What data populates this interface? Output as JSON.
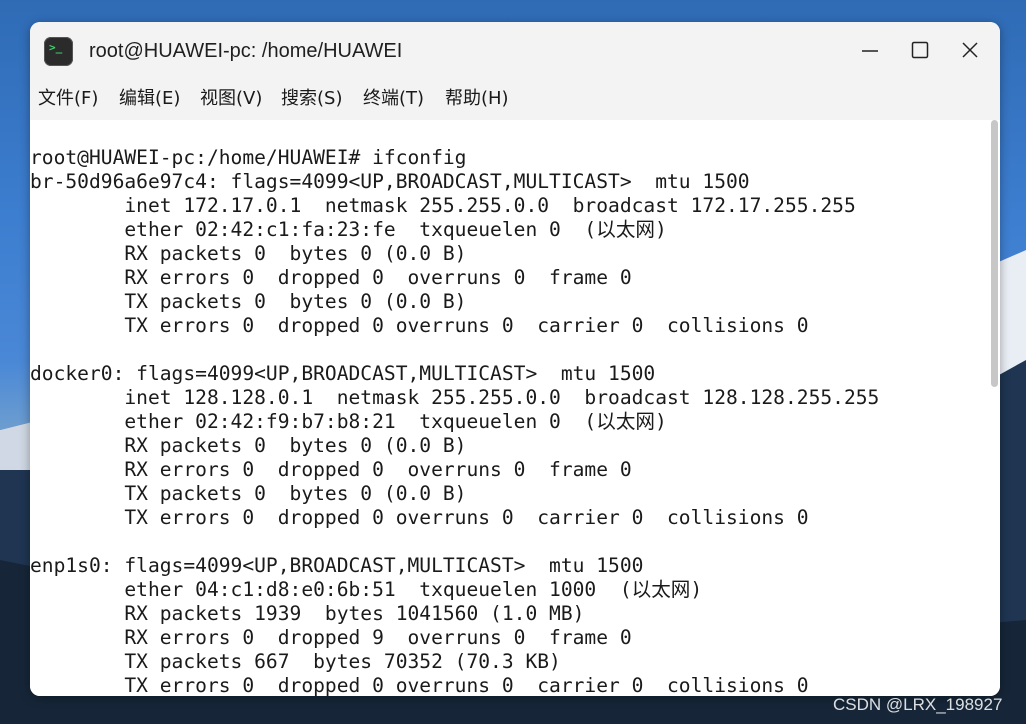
{
  "window": {
    "title": "root@HUAWEI-pc: /home/HUAWEI",
    "app_icon_glyph": ">_"
  },
  "menu": {
    "items": [
      {
        "label": "文件(F)"
      },
      {
        "label": "编辑(E)"
      },
      {
        "label": "视图(V)"
      },
      {
        "label": "搜索(S)"
      },
      {
        "label": "终端(T)"
      },
      {
        "label": "帮助(H)"
      }
    ]
  },
  "terminal": {
    "lines": [
      "root@HUAWEI-pc:/home/HUAWEI# ifconfig",
      "br-50d96a6e97c4: flags=4099<UP,BROADCAST,MULTICAST>  mtu 1500",
      "        inet 172.17.0.1  netmask 255.255.0.0  broadcast 172.17.255.255",
      "        ether 02:42:c1:fa:23:fe  txqueuelen 0  (以太网)",
      "        RX packets 0  bytes 0 (0.0 B)",
      "        RX errors 0  dropped 0  overruns 0  frame 0",
      "        TX packets 0  bytes 0 (0.0 B)",
      "        TX errors 0  dropped 0 overruns 0  carrier 0  collisions 0",
      "",
      "docker0: flags=4099<UP,BROADCAST,MULTICAST>  mtu 1500",
      "        inet 128.128.0.1  netmask 255.255.0.0  broadcast 128.128.255.255",
      "        ether 02:42:f9:b7:b8:21  txqueuelen 0  (以太网)",
      "        RX packets 0  bytes 0 (0.0 B)",
      "        RX errors 0  dropped 0  overruns 0  frame 0",
      "        TX packets 0  bytes 0 (0.0 B)",
      "        TX errors 0  dropped 0 overruns 0  carrier 0  collisions 0",
      "",
      "enp1s0: flags=4099<UP,BROADCAST,MULTICAST>  mtu 1500",
      "        ether 04:c1:d8:e0:6b:51  txqueuelen 1000  (以太网)",
      "        RX packets 1939  bytes 1041560 (1.0 MB)",
      "        RX errors 0  dropped 9  overruns 0  frame 0",
      "        TX packets 667  bytes 70352 (70.3 KB)",
      "        TX errors 0  dropped 0 overruns 0  carrier 0  collisions 0"
    ]
  },
  "watermark": "CSDN @LRX_198927",
  "colors": {
    "terminal_bg": "#ffffff",
    "terminal_fg": "#1a1a1a",
    "titlebar_bg": "#f3f3f3",
    "app_icon_bg": "#2b2b2b",
    "app_icon_glyph": "#3fd26b"
  }
}
